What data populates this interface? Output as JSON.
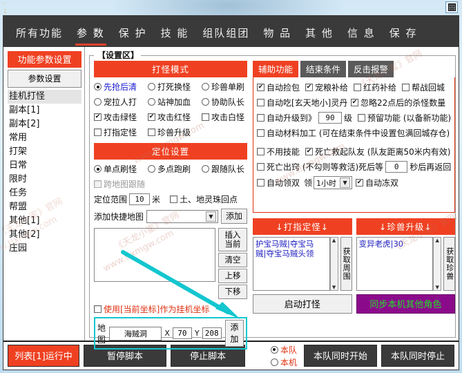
{
  "window": {
    "close_label": "close-icon"
  },
  "nav": {
    "tabs": [
      {
        "label": "所有功能",
        "active": false
      },
      {
        "label": "参  数",
        "active": true
      },
      {
        "label": "保  护",
        "active": false
      },
      {
        "label": "技  能",
        "active": false
      },
      {
        "label": "组队组团",
        "active": false
      },
      {
        "label": "物  品",
        "active": false
      },
      {
        "label": "其  他",
        "active": false
      },
      {
        "label": "信  息",
        "active": false
      },
      {
        "label": "保  存",
        "active": false
      }
    ]
  },
  "sidebar": {
    "header": "功能参数设置",
    "button": "参数设置",
    "items": [
      {
        "label": "挂机打怪",
        "selected": true
      },
      {
        "label": "副本[1]",
        "selected": false
      },
      {
        "label": "副本[2]",
        "selected": false
      },
      {
        "label": "常用",
        "selected": false
      },
      {
        "label": "打架",
        "selected": false
      },
      {
        "label": "日常",
        "selected": false
      },
      {
        "label": "限时",
        "selected": false
      },
      {
        "label": "任务",
        "selected": false
      },
      {
        "label": "帮盟",
        "selected": false
      },
      {
        "label": "其他[1]",
        "selected": false
      },
      {
        "label": "其他[2]",
        "selected": false
      },
      {
        "label": "庄园",
        "selected": false
      }
    ]
  },
  "settings_area": {
    "title": "【设置区】"
  },
  "monster_mode": {
    "header": "打怪模式",
    "radios_row1": [
      {
        "label": "先抢后清",
        "checked": true,
        "style": "blue"
      },
      {
        "label": "打死换怪",
        "checked": false,
        "style": "normal"
      },
      {
        "label": "珍兽单刷",
        "checked": false,
        "style": "normal"
      }
    ],
    "radios_row2": [
      {
        "label": "宠拉人打",
        "checked": false,
        "style": "normal"
      },
      {
        "label": "站神加血",
        "checked": false,
        "style": "normal"
      },
      {
        "label": "协助队长",
        "checked": false,
        "style": "normal"
      }
    ],
    "checks_row3": [
      {
        "label": "攻击绿怪",
        "checked": true
      },
      {
        "label": "攻击红怪",
        "checked": true
      },
      {
        "label": "攻击白怪",
        "checked": false
      }
    ],
    "checks_row4": [
      {
        "label": "打指定怪",
        "checked": false
      },
      {
        "label": "珍兽升级",
        "checked": false
      }
    ]
  },
  "locate": {
    "header": "定位设置",
    "radios": [
      {
        "label": "单点刷怪",
        "checked": true
      },
      {
        "label": "多点跑刷",
        "checked": false
      },
      {
        "label": "跟随队长",
        "checked": false
      }
    ],
    "follow_cross_map": {
      "label": "跨地图跟随",
      "checked": false,
      "disabled": true
    },
    "range_label": "定位范围",
    "range_value": "10",
    "range_unit": "米",
    "earth_bead": {
      "label": "土、地灵珠回点",
      "checked": false
    },
    "quickmap_label": "添加快捷地图",
    "quickmap_value": "",
    "quickmap_add": "添加"
  },
  "list_controls": {
    "insert_current": "插入\n当前",
    "insert_current_line1": "插入",
    "insert_current_line2": "当前",
    "clear": "清空",
    "move_up": "上移",
    "move_down": "下移",
    "items": []
  },
  "use_current_coord": {
    "label": "使用[当前坐标]作为挂机坐标",
    "checked": false
  },
  "map_row": {
    "map_label": "地图",
    "map_value": "海贼洞",
    "x_label": "X",
    "x_value": "70",
    "y_label": "Y",
    "y_value": "208",
    "add_label": "添加"
  },
  "aux": {
    "tabs": [
      {
        "label": "辅助功能",
        "active": true
      },
      {
        "label": "结束条件",
        "active": false
      },
      {
        "label": "反击报警",
        "active": false
      }
    ],
    "row1": [
      {
        "label": "自动捡包",
        "checked": true
      },
      {
        "label": "宠粮补给",
        "checked": true
      },
      {
        "label": "红药补给",
        "checked": false
      },
      {
        "label": "帮战回城",
        "checked": false
      }
    ],
    "row2": [
      {
        "label": "自动吃[玄天地小]灵丹",
        "checked": false
      },
      {
        "label": "忽略22点后的杀怪数量",
        "checked": true
      }
    ],
    "row3": {
      "upgrade_label": "自动升级到》",
      "upgrade_checked": false,
      "level_value": "90",
      "level_unit": "级",
      "reserve": {
        "label": "预留功能 (以备新功能)",
        "checked": false
      }
    },
    "row4": {
      "label": "自动材料加工 (可在结束条件中设置包满回城存仓)",
      "checked": false
    },
    "row5": [
      {
        "label": "不用技能",
        "checked": false
      },
      {
        "label": "死亡救起队友 (队友距离50米内有效)",
        "checked": true
      }
    ],
    "row6": {
      "label_a": "死亡出窍 (不勾则等救活)死后等",
      "checked": false,
      "seconds": "0",
      "label_b": "秒后再返回"
    },
    "row7": {
      "auto_double": {
        "label": "自动领双",
        "checked": false
      },
      "take_label": "领",
      "duration": "1小时",
      "freeze_double": {
        "label": "自动冻双",
        "checked": true
      }
    }
  },
  "target_monster": {
    "header": "↓打指定怪↓",
    "lines": [
      "护宝马贼|夺宝马",
      "贼|夺宝马贼头领"
    ],
    "side_button": "获取周围",
    "action": "启动打怪"
  },
  "pet_upgrade": {
    "header": "↓珍兽升级↓",
    "lines": [
      "变异老虎|30"
    ],
    "side_button": "获取珍兽",
    "action": "同步本机其他角色"
  },
  "statusbar": {
    "state": "列表[1]运行中",
    "pause": "暂停脚本",
    "stop": "停止脚本",
    "scope": [
      {
        "label": "本队",
        "checked": true
      },
      {
        "label": "本机",
        "checked": false
      }
    ],
    "start_all": "本队同时开始",
    "stop_all": "本队同时停止"
  },
  "watermarks": [
    "《天龙小蜜》官网",
    "www.tlxmgw.com"
  ],
  "colors": {
    "accent_red": "#ef4122",
    "nav_dark": "#3a3a3a",
    "highlight_teal": "#13c6cf",
    "sync_purple": "#8b0a8b",
    "sync_green": "#22e02a"
  }
}
